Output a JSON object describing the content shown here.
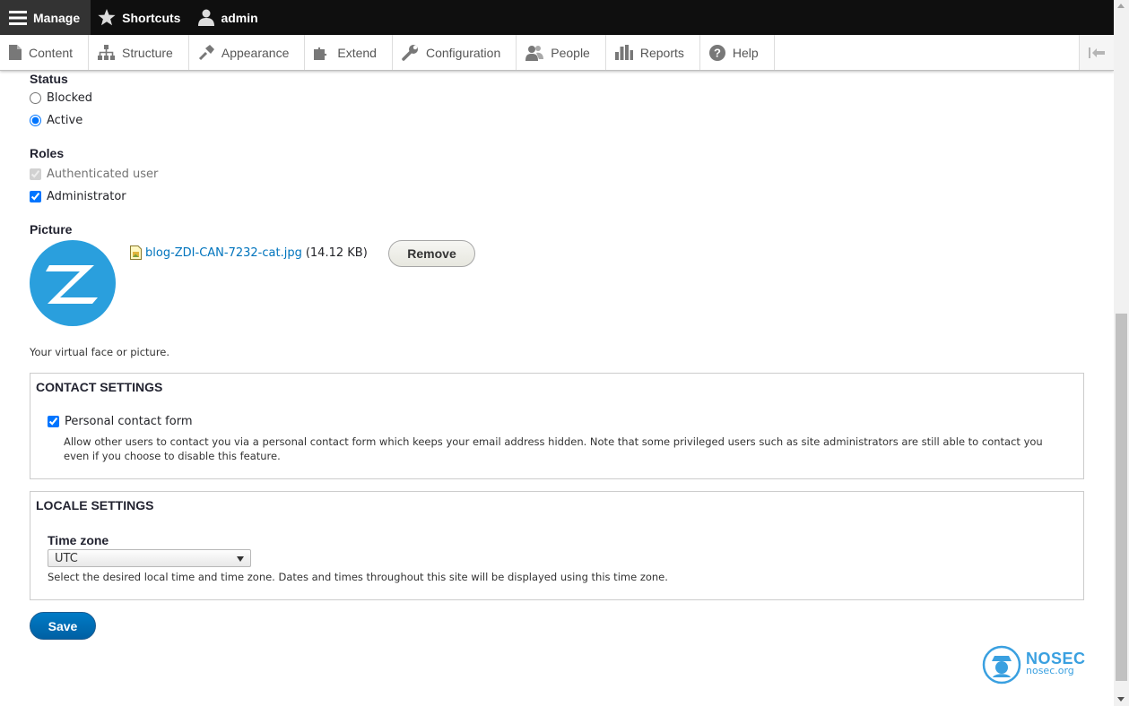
{
  "toolbar": {
    "manage": "Manage",
    "shortcuts": "Shortcuts",
    "user": "admin"
  },
  "tray": {
    "items": [
      "Content",
      "Structure",
      "Appearance",
      "Extend",
      "Configuration",
      "People",
      "Reports",
      "Help"
    ]
  },
  "status": {
    "label": "Status",
    "options": [
      "Blocked",
      "Active"
    ],
    "selected": "Active"
  },
  "roles": {
    "label": "Roles",
    "options": [
      "Authenticated user",
      "Administrator"
    ],
    "checked": [
      "Authenticated user",
      "Administrator"
    ],
    "disabled": [
      "Authenticated user"
    ]
  },
  "picture": {
    "label": "Picture",
    "file_name": "blog-ZDI-CAN-7232-cat.jpg",
    "file_size": "(14.12 KB)",
    "remove_label": "Remove",
    "help": "Your virtual face or picture."
  },
  "contact": {
    "legend": "Contact settings",
    "checkbox_label": "Personal contact form",
    "checked": true,
    "description": "Allow other users to contact you via a personal contact form which keeps your email address hidden. Note that some privileged users such as site administrators are still able to contact you even if you choose to disable this feature."
  },
  "locale": {
    "legend": "Locale settings",
    "timezone_label": "Time zone",
    "timezone_value": "UTC",
    "description": "Select the desired local time and time zone. Dates and times throughout this site will be displayed using this time zone."
  },
  "actions": {
    "save_label": "Save"
  },
  "watermark": {
    "brand": "NOSEC",
    "url": "nosec.org"
  },
  "colors": {
    "toolbar_bg": "#0f0f0f",
    "link": "#0074bd",
    "primary_button": "#0071b8",
    "avatar_blue": "#2a9fdd"
  }
}
